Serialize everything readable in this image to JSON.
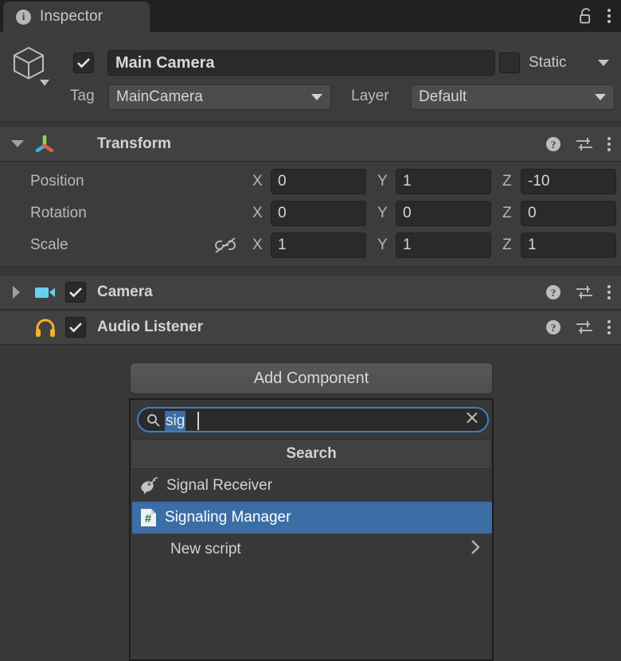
{
  "window": {
    "tab_label": "Inspector",
    "tab_icon": "info-icon",
    "lock_icon": "lock-open-icon",
    "menu_icon": "kebab-menu-icon"
  },
  "object_header": {
    "enabled_checkbox": true,
    "object_icon": "gameobject-cube-icon",
    "name": "Main Camera",
    "static_label": "Static",
    "static_checked": false,
    "tag_label": "Tag",
    "tag_value": "MainCamera",
    "layer_label": "Layer",
    "layer_value": "Default"
  },
  "components": [
    {
      "name": "Transform",
      "icon": "transform-axis-icon",
      "expanded": true,
      "help_icon": "help-icon",
      "preset_icon": "preset-sliders-icon",
      "menu_icon": "kebab-menu-icon",
      "properties": [
        {
          "label": "Position",
          "x": "0",
          "y": "1",
          "z": "-10"
        },
        {
          "label": "Rotation",
          "x": "0",
          "y": "0",
          "z": "0"
        },
        {
          "label": "Scale",
          "x": "1",
          "y": "1",
          "z": "1",
          "link_icon": "broken-link-icon"
        }
      ],
      "axis_labels": {
        "x": "X",
        "y": "Y",
        "z": "Z"
      }
    },
    {
      "name": "Camera",
      "icon": "camera-icon",
      "expanded": false,
      "enabled": true,
      "help_icon": "help-icon",
      "preset_icon": "preset-sliders-icon",
      "menu_icon": "kebab-menu-icon"
    },
    {
      "name": "Audio Listener",
      "icon": "headphones-icon",
      "expanded": false,
      "enabled": true,
      "help_icon": "help-icon",
      "preset_icon": "preset-sliders-icon",
      "menu_icon": "kebab-menu-icon"
    }
  ],
  "add_component": {
    "button_label": "Add Component",
    "search": {
      "icon": "search-icon",
      "value": "sig",
      "clear_icon": "clear-x-icon"
    },
    "section_header": "Search",
    "results": [
      {
        "label": "Signal Receiver",
        "icon": "satellite-dish-icon",
        "selected": false
      },
      {
        "label": "Signaling Manager",
        "icon": "csharp-script-icon",
        "selected": true
      },
      {
        "label": "New script",
        "icon": "none",
        "selected": false,
        "submenu_icon": "chevron-right-icon"
      }
    ]
  },
  "colors": {
    "panel_bg": "#383838",
    "header_bg": "#3c3c3c",
    "component_header_bg": "#414141",
    "field_bg": "#2a2a2a",
    "selection_blue": "#3a6ea5",
    "focus_blue": "#3f7ec4",
    "text": "#d3d3d3"
  }
}
